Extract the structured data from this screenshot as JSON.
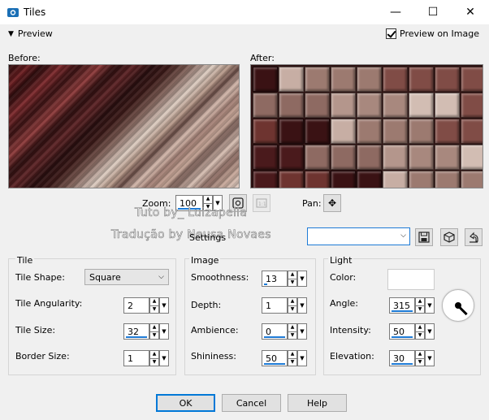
{
  "window": {
    "title": "Tiles",
    "minimize": "—",
    "maximize": "☐",
    "close": "✕"
  },
  "preview": {
    "toggle_label": "Preview",
    "preview_on_image_label": "Preview on Image",
    "preview_on_image_checked": true,
    "before_label": "Before:",
    "after_label": "After:"
  },
  "zoom": {
    "label": "Zoom:",
    "value": "100",
    "pan_label": "Pan:"
  },
  "watermark": {
    "line1": "Tuto by_ Luizapella",
    "line2": "Tradução by Neusa Novaes"
  },
  "settings": {
    "label": "Settings",
    "selected": ""
  },
  "tile_group": {
    "title": "Tile",
    "shape_label": "Tile Shape:",
    "shape_value": "Square",
    "angularity_label": "Tile Angularity:",
    "angularity_value": "2",
    "size_label": "Tile Size:",
    "size_value": "32",
    "border_label": "Border Size:",
    "border_value": "1"
  },
  "image_group": {
    "title": "Image",
    "smoothness_label": "Smoothness:",
    "smoothness_value": "13",
    "depth_label": "Depth:",
    "depth_value": "1",
    "ambience_label": "Ambience:",
    "ambience_value": "0",
    "shininess_label": "Shininess:",
    "shininess_value": "50"
  },
  "light_group": {
    "title": "Light",
    "color_label": "Color:",
    "color_value": "#ffffff",
    "angle_label": "Angle:",
    "angle_value": "315",
    "intensity_label": "Intensity:",
    "intensity_value": "50",
    "elevation_label": "Elevation:",
    "elevation_value": "30"
  },
  "buttons": {
    "ok": "OK",
    "cancel": "Cancel",
    "help": "Help"
  },
  "colors": {
    "accent": "#0078d7",
    "spin_underline": "#1e7bd6"
  }
}
